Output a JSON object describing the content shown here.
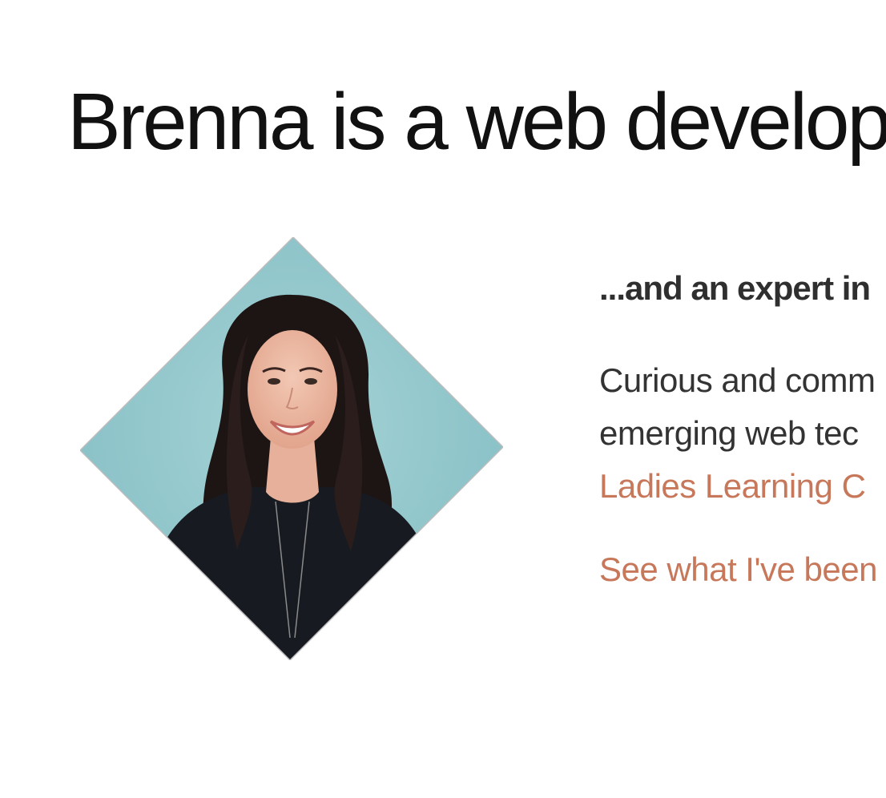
{
  "hero": {
    "headline": "Brenna is a web develop"
  },
  "portrait": {
    "subject": "smiling woman with long dark hair",
    "background_color": "#8ec6cb",
    "shape": "diamond"
  },
  "about": {
    "subhead": "...and an expert in",
    "bio_line_1": "Curious and comm",
    "bio_line_2": "emerging web tec",
    "bio_link": "Ladies Learning C",
    "see_more_link": "See what I've been"
  },
  "colors": {
    "accent": "#c8785a",
    "text": "#333333",
    "headline": "#111111"
  }
}
